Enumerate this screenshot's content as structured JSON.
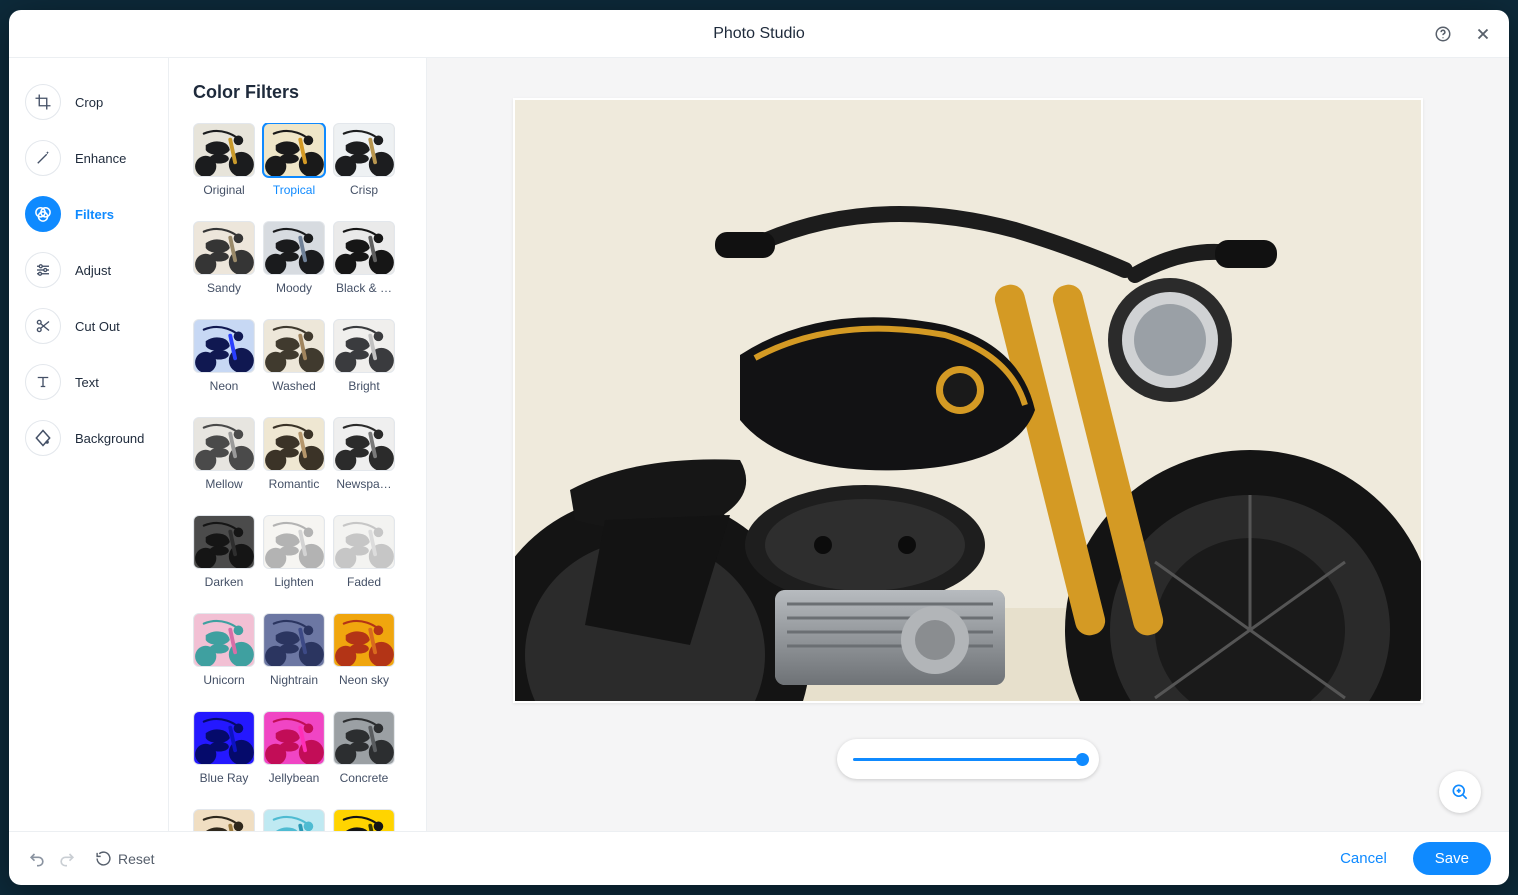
{
  "header": {
    "title": "Photo Studio"
  },
  "sidebar": {
    "items": [
      {
        "label": "Crop",
        "icon": "crop"
      },
      {
        "label": "Enhance",
        "icon": "wand"
      },
      {
        "label": "Filters",
        "icon": "filters",
        "active": true
      },
      {
        "label": "Adjust",
        "icon": "sliders"
      },
      {
        "label": "Cut Out",
        "icon": "scissors"
      },
      {
        "label": "Text",
        "icon": "text"
      },
      {
        "label": "Background",
        "icon": "diamond"
      }
    ]
  },
  "panel": {
    "title": "Color Filters",
    "filters": [
      {
        "label": "Original",
        "style": "original"
      },
      {
        "label": "Tropical",
        "style": "tropical",
        "selected": true
      },
      {
        "label": "Crisp",
        "style": "crisp"
      },
      {
        "label": "Sandy",
        "style": "sandy"
      },
      {
        "label": "Moody",
        "style": "moody"
      },
      {
        "label": "Black & …",
        "style": "bw"
      },
      {
        "label": "Neon",
        "style": "neon"
      },
      {
        "label": "Washed",
        "style": "washed"
      },
      {
        "label": "Bright",
        "style": "bright"
      },
      {
        "label": "Mellow",
        "style": "mellow"
      },
      {
        "label": "Romantic",
        "style": "romantic"
      },
      {
        "label": "Newspa…",
        "style": "newspaper"
      },
      {
        "label": "Darken",
        "style": "darken"
      },
      {
        "label": "Lighten",
        "style": "lighten"
      },
      {
        "label": "Faded",
        "style": "faded"
      },
      {
        "label": "Unicorn",
        "style": "unicorn"
      },
      {
        "label": "Nightrain",
        "style": "nightrain"
      },
      {
        "label": "Neon sky",
        "style": "neonsky"
      },
      {
        "label": "Blue Ray",
        "style": "blueray"
      },
      {
        "label": "Jellybean",
        "style": "jellybean"
      },
      {
        "label": "Concrete",
        "style": "concrete"
      },
      {
        "label": "",
        "style": "extra1"
      },
      {
        "label": "",
        "style": "extra2"
      },
      {
        "label": "",
        "style": "extra3"
      }
    ]
  },
  "slider": {
    "value": 100
  },
  "footer": {
    "reset": "Reset",
    "cancel": "Cancel",
    "save": "Save"
  },
  "filter_styles": {
    "original": {
      "bg": "#e7e4da",
      "bike": "#1b1c1e",
      "accent": "#c99a2b"
    },
    "tropical": {
      "bg": "#efe6c8",
      "bike": "#1a1a1a",
      "accent": "#d49a24"
    },
    "crisp": {
      "bg": "#eef1f3",
      "bike": "#1c1d1f",
      "accent": "#b8964f"
    },
    "sandy": {
      "bg": "#ede6db",
      "bike": "#353535",
      "accent": "#9a8a6a"
    },
    "moody": {
      "bg": "#d7dbe0",
      "bike": "#1a1b1d",
      "accent": "#708198"
    },
    "bw": {
      "bg": "#eaeaea",
      "bike": "#161616",
      "accent": "#606060"
    },
    "neon": {
      "bg": "#c7d8f4",
      "bike": "#101851",
      "accent": "#2a3fff"
    },
    "washed": {
      "bg": "#ede7d9",
      "bike": "#403a2e",
      "accent": "#a1855e"
    },
    "bright": {
      "bg": "#f0efed",
      "bike": "#3a3b3e",
      "accent": "#c1c1c1"
    },
    "mellow": {
      "bg": "#e7e5e0",
      "bike": "#4a4a4a",
      "accent": "#9a9a9a"
    },
    "romantic": {
      "bg": "#efe7d2",
      "bike": "#3b3327",
      "accent": "#b5966b"
    },
    "newspaper": {
      "bg": "#efefef",
      "bike": "#2b2b2b",
      "accent": "#7a7a7a"
    },
    "darken": {
      "bg": "#4b4b4b",
      "bike": "#151515",
      "accent": "#2e2e2e"
    },
    "lighten": {
      "bg": "#f6f5f2",
      "bike": "#b3b3b3",
      "accent": "#d3d3d3"
    },
    "faded": {
      "bg": "#f3f3f1",
      "bike": "#c6c6c6",
      "accent": "#dcdcdc"
    },
    "unicorn": {
      "bg": "#f2c0d4",
      "bike": "#3fa0a0",
      "accent": "#d86ea7"
    },
    "nightrain": {
      "bg": "#6c77a3",
      "bike": "#2b3560",
      "accent": "#3d4a86"
    },
    "neonsky": {
      "bg": "#f0a60e",
      "bike": "#b33416",
      "accent": "#d86a1e"
    },
    "blueray": {
      "bg": "#2418ff",
      "bike": "#050a6b",
      "accent": "#0c12c2"
    },
    "jellybean": {
      "bg": "#f045c4",
      "bike": "#c20d57",
      "accent": "#ff2fb7"
    },
    "concrete": {
      "bg": "#9ba0a4",
      "bike": "#2c2e30",
      "accent": "#5a5d60"
    },
    "extra1": {
      "bg": "#f0dec2",
      "bike": "#2f281c",
      "accent": "#9a7a3e"
    },
    "extra2": {
      "bg": "#bfe9f2",
      "bike": "#4ebbd2",
      "accent": "#2a99b4"
    },
    "extra3": {
      "bg": "#ffd400",
      "bike": "#141414",
      "accent": "#3a3a00"
    }
  }
}
